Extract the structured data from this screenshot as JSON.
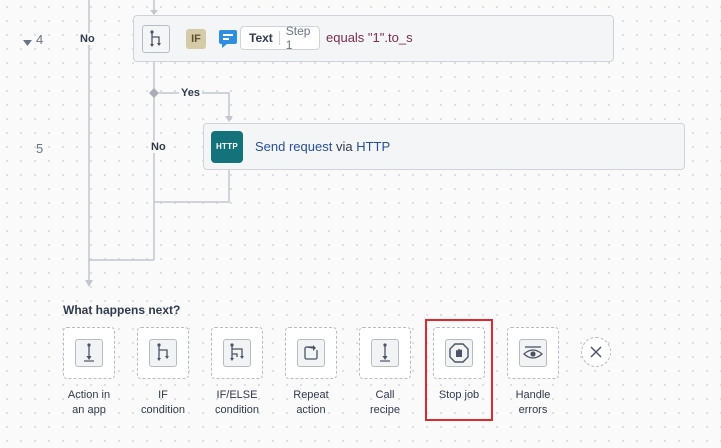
{
  "steps": {
    "step4": {
      "number": "4",
      "branch_label": "No",
      "if_badge": "IF",
      "pill_name": "Text",
      "pill_step": "Step 1",
      "condition": "equals \"1\".to_s",
      "icons": [
        "collapse-caret-icon",
        "if-branch-icon",
        "text-app-icon"
      ]
    },
    "yes_label": "Yes",
    "step5": {
      "number": "5",
      "branch_label": "No",
      "logo_text": "HTTP",
      "action_text": "Send request",
      "via_text": "via",
      "app_text": "HTTP"
    }
  },
  "next": {
    "title": "What happens next?",
    "options": [
      {
        "line1": "Action in",
        "line2": "an app",
        "icon": "action-icon"
      },
      {
        "line1": "IF",
        "line2": "condition",
        "icon": "if-condition-icon"
      },
      {
        "line1": "IF/ELSE",
        "line2": "condition",
        "icon": "if-else-icon"
      },
      {
        "line1": "Repeat",
        "line2": "action",
        "icon": "repeat-icon"
      },
      {
        "line1": "Call",
        "line2": "recipe",
        "icon": "call-recipe-icon"
      },
      {
        "line1": "Stop job",
        "line2": "",
        "icon": "stop-hand-icon"
      },
      {
        "line1": "Handle",
        "line2": "errors",
        "icon": "eye-icon"
      }
    ],
    "close_icon": "close-icon",
    "highlight_color": "#e0292f"
  }
}
